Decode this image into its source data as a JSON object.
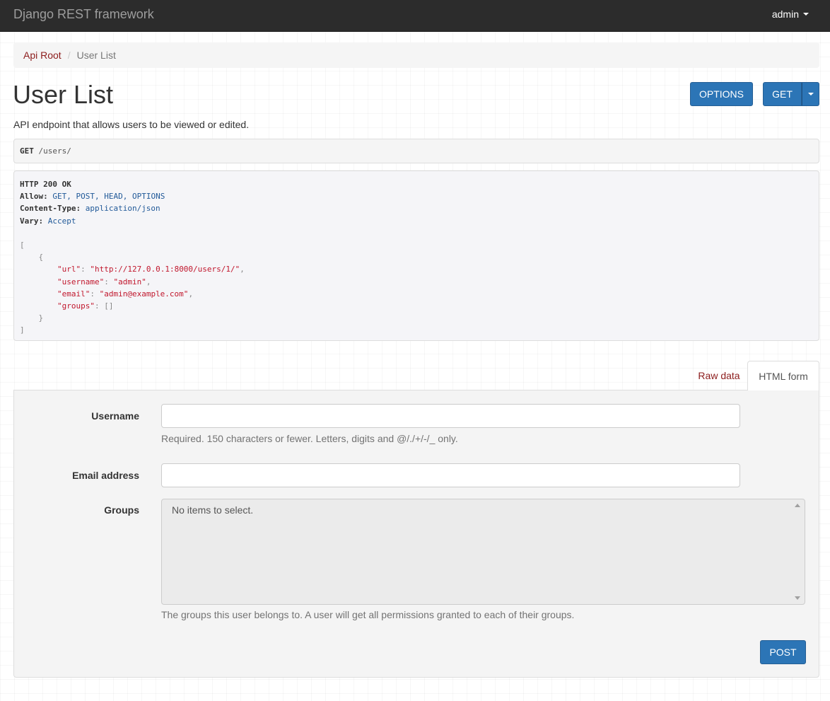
{
  "navbar": {
    "brand": "Django REST framework",
    "user": "admin"
  },
  "breadcrumb": {
    "root": "Api Root",
    "separator": "/",
    "current": "User List"
  },
  "page": {
    "title": "User List",
    "description": "API endpoint that allows users to be viewed or edited."
  },
  "actions": {
    "options_label": "OPTIONS",
    "get_label": "GET"
  },
  "request": {
    "method": "GET",
    "path": "/users/"
  },
  "response": {
    "status": "HTTP 200 OK",
    "headers": [
      {
        "key": "Allow:",
        "value": "GET, POST, HEAD, OPTIONS"
      },
      {
        "key": "Content-Type:",
        "value": "application/json"
      },
      {
        "key": "Vary:",
        "value": "Accept"
      }
    ],
    "body": {
      "open_bracket": "[",
      "open_brace": "{",
      "fields": [
        {
          "key": "\"url\"",
          "value": "\"http://127.0.0.1:8000/users/1/\"",
          "comma": ","
        },
        {
          "key": "\"username\"",
          "value": "\"admin\"",
          "comma": ","
        },
        {
          "key": "\"email\"",
          "value": "\"admin@example.com\"",
          "comma": ","
        },
        {
          "key": "\"groups\"",
          "value": "[]",
          "comma": ""
        }
      ],
      "close_brace": "}",
      "close_bracket": "]"
    }
  },
  "tabs": {
    "raw": "Raw data",
    "html": "HTML form"
  },
  "form": {
    "username_label": "Username",
    "username_value": "",
    "username_help": "Required. 150 characters or fewer. Letters, digits and @/./+/-/_ only.",
    "email_label": "Email address",
    "email_value": "",
    "groups_label": "Groups",
    "groups_empty": "No items to select.",
    "groups_help": "The groups this user belongs to. A user will get all permissions granted to each of their groups.",
    "submit_label": "POST"
  },
  "colors": {
    "navbar_bg": "#2c2c2c",
    "button_primary": "#2c75b6",
    "link": "#8c1c1c",
    "json_string": "#c1172d",
    "header_value": "#225a99"
  }
}
